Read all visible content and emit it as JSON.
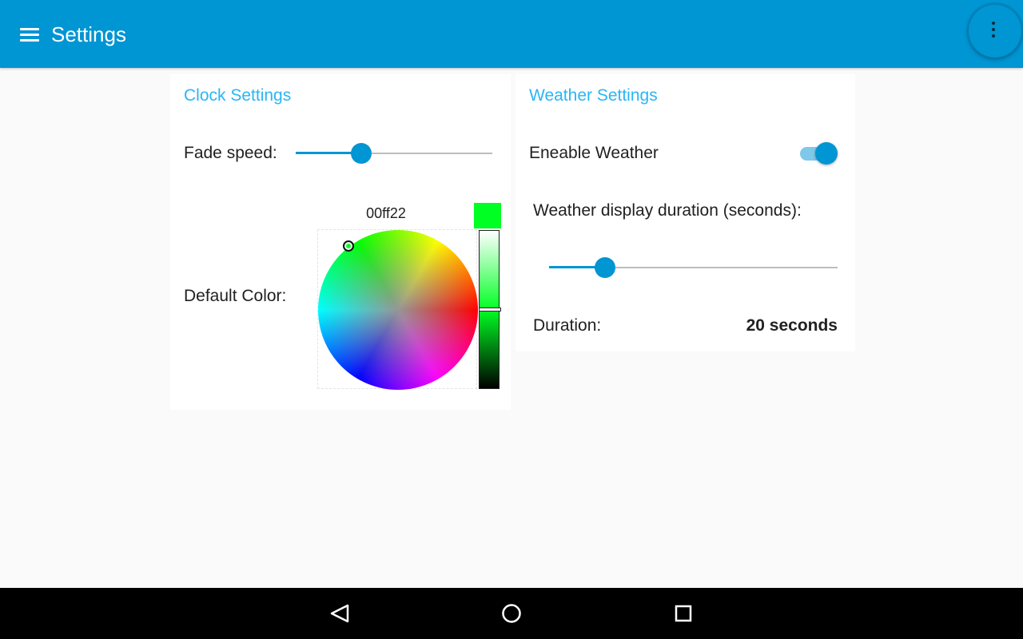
{
  "app_bar": {
    "title": "Settings",
    "menu_icon": "hamburger-menu-icon",
    "overflow_icon": "more-vert-icon",
    "color": "#0095d3"
  },
  "clock_settings": {
    "title": "Clock Settings",
    "fade_speed": {
      "label": "Fade speed:",
      "value_fraction": 0.335
    },
    "default_color": {
      "label": "Default Color:",
      "hex": "00ff22",
      "swatch_color": "#00ff22",
      "brightness_fraction": 0.5
    }
  },
  "weather_settings": {
    "title": "Weather Settings",
    "enable_weather": {
      "label": "Eneable Weather",
      "checked": true
    },
    "display_duration": {
      "label": "Weather display duration (seconds):",
      "value_fraction": 0.195
    },
    "duration": {
      "label": "Duration:",
      "value": "20 seconds"
    }
  },
  "nav_bar": {
    "back_icon": "back-triangle-icon",
    "home_icon": "home-circle-icon",
    "recents_icon": "recents-square-icon"
  },
  "colors": {
    "accent": "#0095d3",
    "card_title": "#29b6f6",
    "background": "#fafafa"
  }
}
